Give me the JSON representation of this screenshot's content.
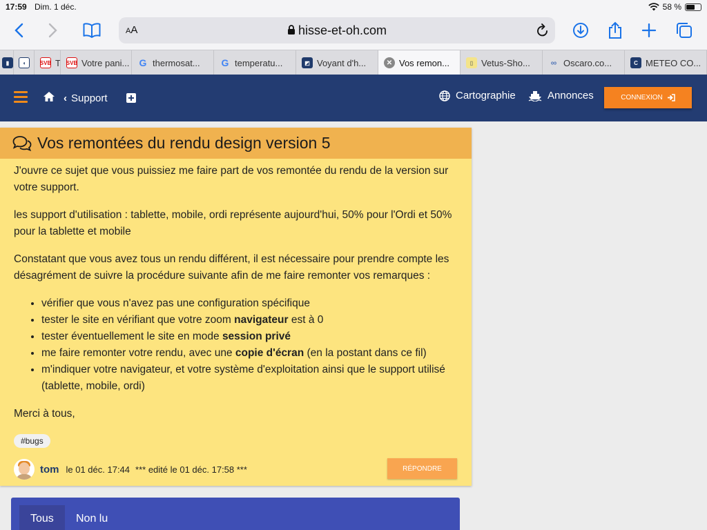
{
  "status_bar": {
    "time": "17:59",
    "date": "Dim. 1 déc.",
    "battery": "58 %",
    "battery_level": 0.58
  },
  "browser": {
    "aa": "AA",
    "url": "hisse-et-oh.com",
    "tabs": [
      {
        "label": "",
        "icon": "tab-icon-1"
      },
      {
        "label": "",
        "icon": "tab-icon-2"
      },
      {
        "label": "T",
        "icon": "svb-icon"
      },
      {
        "label": "Votre pani...",
        "icon": "svb-icon"
      },
      {
        "label": "thermosat...",
        "icon": "google-icon"
      },
      {
        "label": "temperatu...",
        "icon": "google-icon"
      },
      {
        "label": "Voyant d'h...",
        "icon": "site-icon"
      },
      {
        "label": "Vos remon...",
        "icon": "close-tab-icon"
      },
      {
        "label": "Vetus-Sho...",
        "icon": "vetus-icon"
      },
      {
        "label": "Oscaro.co...",
        "icon": "oscaro-icon"
      },
      {
        "label": "METEO CO...",
        "icon": "meteo-icon"
      }
    ]
  },
  "site_nav": {
    "back_label": "Support",
    "cartographie": "Cartographie",
    "annonces": "Annonces",
    "connexion": "CONNEXION"
  },
  "post": {
    "title": "Vos remontées du rendu design version 5",
    "p1": "J'ouvre ce sujet que vous puissiez me faire part de vos remontée du rendu de la version sur votre support.",
    "p2": "les support d'utilisation : tablette, mobile, ordi représente aujourd'hui, 50% pour l'Ordi et 50% pour la tablette et mobile",
    "p3": "Constatant que vous avez tous un rendu différent, il est nécessaire pour prendre compte les désagrément de suivre la procédure suivante afin de me faire remonter vos remarques :",
    "list": {
      "item1": "vérifier que vous n'avez pas une configuration spécifique",
      "item2_pre": "tester le site en vérifiant que votre zoom ",
      "item2_bold": "navigateur",
      "item2_post": " est à 0",
      "item3_pre": "tester éventuellement le site en mode ",
      "item3_bold": "session privé",
      "item4_pre": "me faire remonter votre rendu, avec une ",
      "item4_bold": "copie d'écran",
      "item4_post": " (en la postant dans ce fil)",
      "item5": "m'indiquer votre navigateur, et votre système d'exploitation ainsi que le support utilisé (tablette, mobile, ordi)"
    },
    "closing": "Merci à tous,",
    "tag": "#bugs",
    "author": "tom",
    "date": "le 01 déc. 17:44",
    "edited": "*** edité le 01 déc. 17:58 ***",
    "reply": "RÉPONDRE"
  },
  "filter_tabs": {
    "all": "Tous",
    "unread": "Non lu"
  },
  "colors": {
    "nav": "#233c72",
    "accent": "#f58220",
    "card": "#fde47f",
    "card_header": "#f0b24f",
    "filter": "#3f4fb5"
  }
}
